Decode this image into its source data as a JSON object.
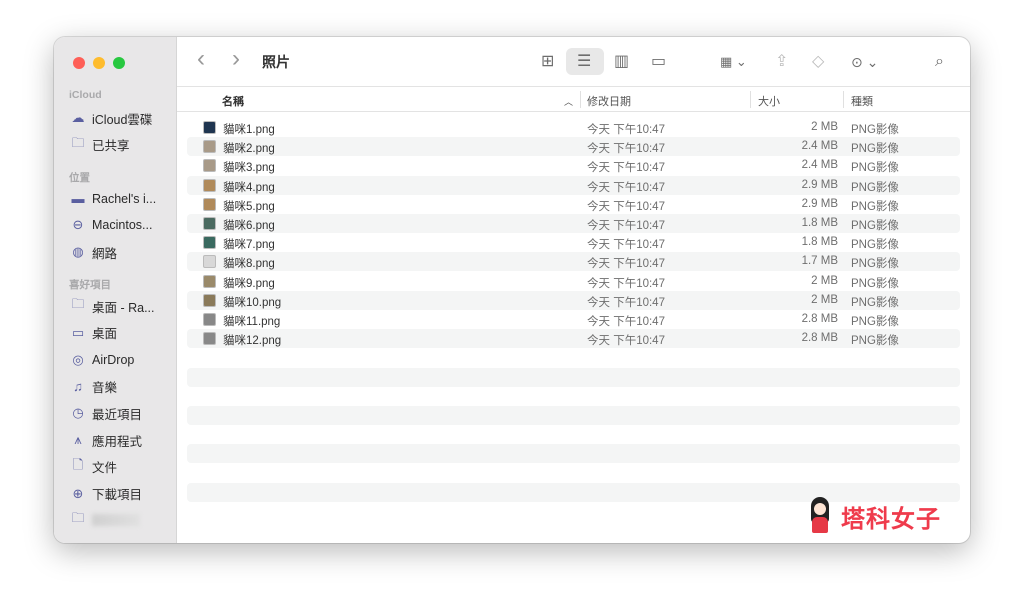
{
  "toolbar": {
    "title": "照片",
    "back": "‹",
    "forward": "›"
  },
  "sidebar": {
    "sections": [
      {
        "label": "iCloud",
        "items": [
          {
            "label": "iCloud雲碟",
            "icon": "cloud-icon"
          },
          {
            "label": "已共享",
            "icon": "shared-folder-icon"
          }
        ]
      },
      {
        "label": "位置",
        "items": [
          {
            "label": "Rachel's i...",
            "icon": "computer-icon"
          },
          {
            "label": "Macintos...",
            "icon": "disk-icon"
          },
          {
            "label": "網路",
            "icon": "network-icon"
          }
        ]
      },
      {
        "label": "喜好項目",
        "items": [
          {
            "label": "桌面 - Ra...",
            "icon": "folder-icon"
          },
          {
            "label": "桌面",
            "icon": "desktop-icon"
          },
          {
            "label": "AirDrop",
            "icon": "airdrop-icon"
          },
          {
            "label": "音樂",
            "icon": "music-icon"
          },
          {
            "label": "最近項目",
            "icon": "clock-icon"
          },
          {
            "label": "應用程式",
            "icon": "apps-icon"
          },
          {
            "label": "文件",
            "icon": "document-icon"
          },
          {
            "label": "下載項目",
            "icon": "download-icon"
          }
        ]
      }
    ]
  },
  "columns": {
    "name": "名稱",
    "date": "修改日期",
    "size": "大小",
    "kind": "種類"
  },
  "files": [
    {
      "name": "貓咪1.png",
      "date": "今天 下午10:47",
      "size": "2 MB",
      "kind": "PNG影像"
    },
    {
      "name": "貓咪2.png",
      "date": "今天 下午10:47",
      "size": "2.4 MB",
      "kind": "PNG影像"
    },
    {
      "name": "貓咪3.png",
      "date": "今天 下午10:47",
      "size": "2.4 MB",
      "kind": "PNG影像"
    },
    {
      "name": "貓咪4.png",
      "date": "今天 下午10:47",
      "size": "2.9 MB",
      "kind": "PNG影像"
    },
    {
      "name": "貓咪5.png",
      "date": "今天 下午10:47",
      "size": "2.9 MB",
      "kind": "PNG影像"
    },
    {
      "name": "貓咪6.png",
      "date": "今天 下午10:47",
      "size": "1.8 MB",
      "kind": "PNG影像"
    },
    {
      "name": "貓咪7.png",
      "date": "今天 下午10:47",
      "size": "1.8 MB",
      "kind": "PNG影像"
    },
    {
      "name": "貓咪8.png",
      "date": "今天 下午10:47",
      "size": "1.7 MB",
      "kind": "PNG影像"
    },
    {
      "name": "貓咪9.png",
      "date": "今天 下午10:47",
      "size": "2 MB",
      "kind": "PNG影像"
    },
    {
      "name": "貓咪10.png",
      "date": "今天 下午10:47",
      "size": "2 MB",
      "kind": "PNG影像"
    },
    {
      "name": "貓咪11.png",
      "date": "今天 下午10:47",
      "size": "2.8 MB",
      "kind": "PNG影像"
    },
    {
      "name": "貓咪12.png",
      "date": "今天 下午10:47",
      "size": "2.8 MB",
      "kind": "PNG影像"
    }
  ],
  "watermark": {
    "text": "塔科女子"
  },
  "colors": {
    "close": "#fe5f57",
    "minimize": "#febc2e",
    "zoom": "#28c840",
    "sidebar_icon": "#5a5fa0",
    "watermark": "#ef3b4c"
  }
}
